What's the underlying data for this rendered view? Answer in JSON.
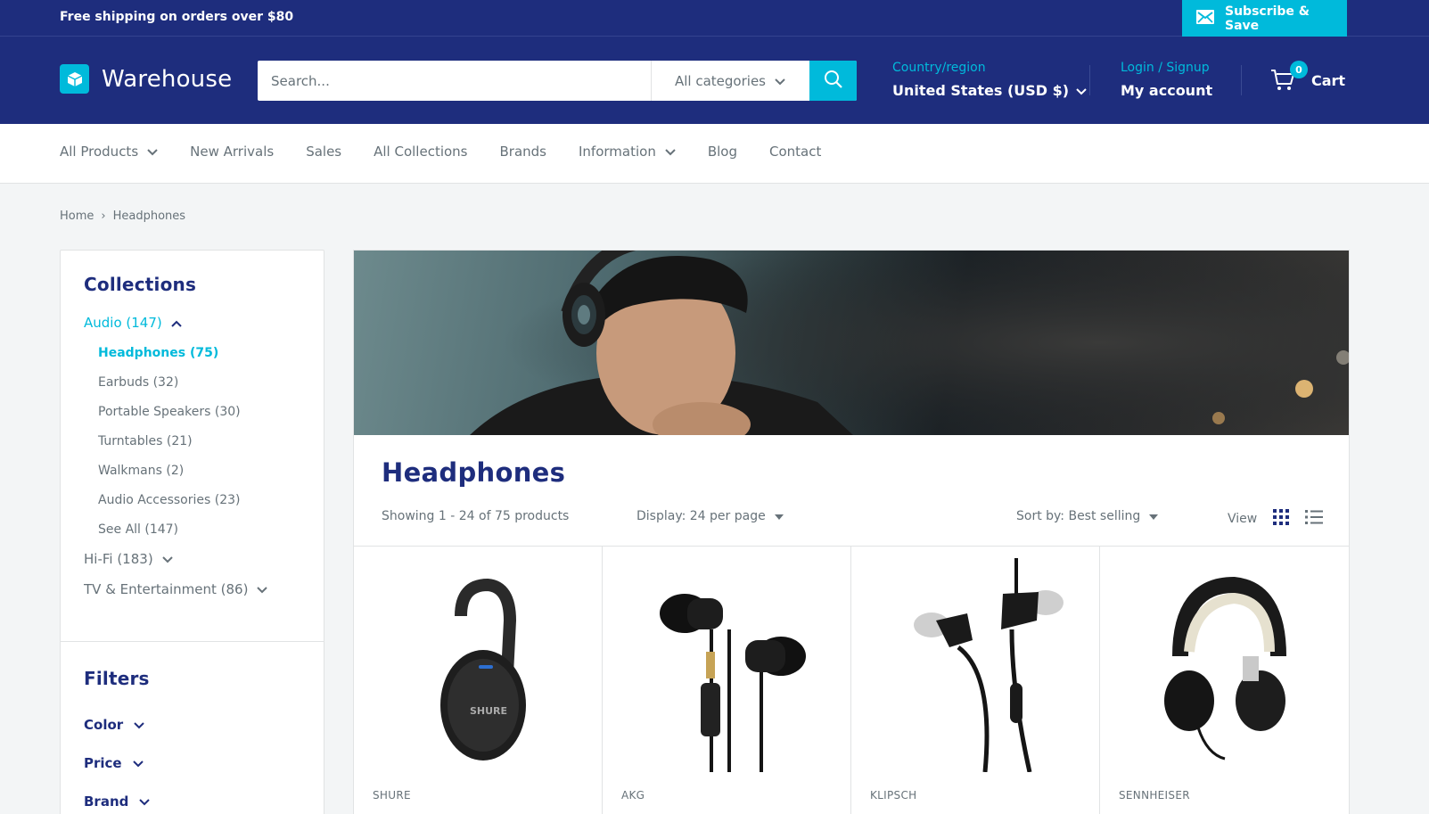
{
  "announcement": {
    "text": "Free shipping on orders over $80",
    "subscribe_label": "Subscribe & Save"
  },
  "header": {
    "logo_text": "Warehouse",
    "search": {
      "placeholder": "Search...",
      "category": "All categories"
    },
    "country": {
      "label": "Country/region",
      "value": "United States (USD $)"
    },
    "account": {
      "label": "Login / Signup",
      "value": "My account"
    },
    "cart": {
      "label": "Cart",
      "count": "0"
    }
  },
  "nav": {
    "items": [
      {
        "label": "All Products",
        "dropdown": true
      },
      {
        "label": "New Arrivals",
        "dropdown": false
      },
      {
        "label": "Sales",
        "dropdown": false
      },
      {
        "label": "All Collections",
        "dropdown": false
      },
      {
        "label": "Brands",
        "dropdown": false
      },
      {
        "label": "Information",
        "dropdown": true
      },
      {
        "label": "Blog",
        "dropdown": false
      },
      {
        "label": "Contact",
        "dropdown": false
      }
    ]
  },
  "breadcrumb": {
    "home": "Home",
    "separator": "›",
    "current": "Headphones"
  },
  "sidebar": {
    "collections_title": "Collections",
    "audio": "Audio (147)",
    "audio_children": [
      "Headphones (75)",
      "Earbuds (32)",
      "Portable Speakers (30)",
      "Turntables (21)",
      "Walkmans (2)",
      "Audio Accessories (23)",
      "See All (147)"
    ],
    "hifi": "Hi-Fi (183)",
    "tv": "TV & Entertainment (86)",
    "filters_title": "Filters",
    "filters": [
      "Color",
      "Price",
      "Brand"
    ]
  },
  "main": {
    "title": "Headphones",
    "showing": "Showing 1 - 24 of 75 products",
    "display": "Display: 24 per page",
    "sort": "Sort by: Best selling",
    "view_label": "View"
  },
  "products": [
    {
      "brand": "SHURE"
    },
    {
      "brand": "AKG"
    },
    {
      "brand": "KLIPSCH"
    },
    {
      "brand": "SENNHEISER"
    }
  ],
  "colors": {
    "primary": "#1e2d7d",
    "accent": "#00badb",
    "text": "#677279",
    "border": "#e1e3e4"
  }
}
